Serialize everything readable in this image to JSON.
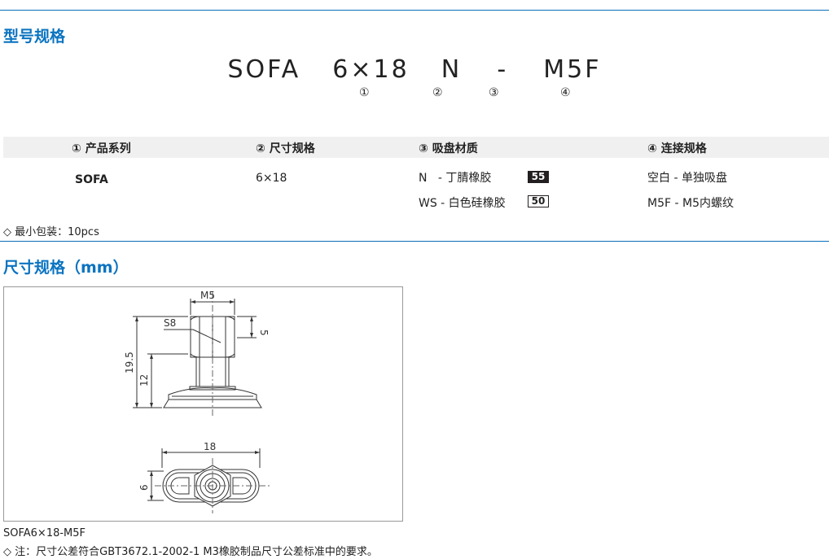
{
  "sections": {
    "model_title": "型号规格",
    "dimension_title": "尺寸规格（mm）"
  },
  "model_code": {
    "series": "SOFA",
    "size": "6×18",
    "material": "N",
    "dash": "-",
    "connection": "M5F"
  },
  "markers": [
    "①",
    "②",
    "③",
    "④"
  ],
  "table": {
    "headers": [
      "① 产品系列",
      "② 尺寸规格",
      "③ 吸盘材质",
      "④ 连接规格"
    ],
    "series_value": "SOFA",
    "size_value": "6×18",
    "materials": [
      {
        "label": "N   - 丁腈橡胶",
        "badge": "55",
        "badge_style": "dark"
      },
      {
        "label": "WS - 白色硅橡胶",
        "badge": "50",
        "badge_style": "light"
      }
    ],
    "connections": [
      "空白 - 单独吸盘",
      "M5F - M5内螺纹"
    ]
  },
  "packaging_note": "◇ 最小包装：10pcs",
  "drawing": {
    "labels": {
      "m5": "M5",
      "s8": "S8",
      "d5": "5",
      "d195": "19.5",
      "d12": "12",
      "d18": "18",
      "d6": "6"
    }
  },
  "caption": "SOFA6×18-M5F",
  "footnote": "◇ 注：尺寸公差符合GBT3672.1-2002-1 M3橡胶制品尺寸公差标准中的要求。",
  "colors": {
    "accent": "#0a73c0",
    "rule": "#0a6fb7",
    "header_bg": "#f0f0f0"
  }
}
